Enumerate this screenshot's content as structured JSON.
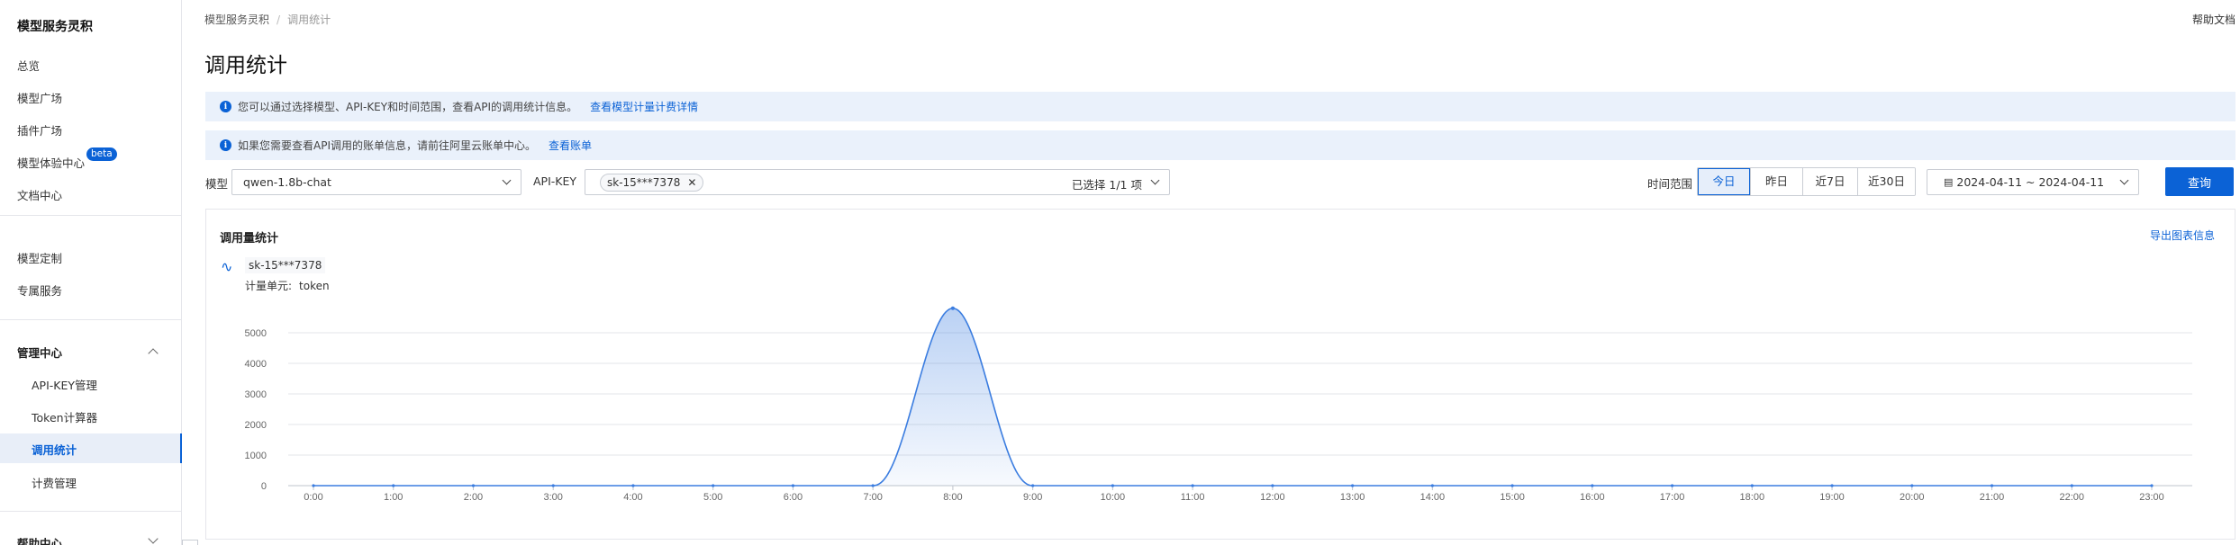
{
  "sidebar": {
    "brand": "模型服务灵积",
    "items": [
      {
        "label": "总览"
      },
      {
        "label": "模型广场"
      },
      {
        "label": "插件广场"
      },
      {
        "label": "模型体验中心",
        "badge": "beta"
      },
      {
        "label": "文档中心"
      }
    ],
    "items2": [
      {
        "label": "模型定制"
      },
      {
        "label": "专属服务"
      }
    ],
    "management": {
      "title": "管理中心",
      "items": [
        {
          "label": "API-KEY管理"
        },
        {
          "label": "Token计算器"
        },
        {
          "label": "调用统计",
          "active": true
        },
        {
          "label": "计费管理"
        }
      ]
    },
    "help": {
      "title": "帮助中心"
    }
  },
  "breadcrumb": {
    "root": "模型服务灵积",
    "separator": "/",
    "current": "调用统计"
  },
  "help_link": "帮助文档",
  "page_title": "调用统计",
  "notices": [
    {
      "text": "您可以通过选择模型、API-KEY和时间范围，查看API的调用统计信息。",
      "link": "查看模型计量计费详情"
    },
    {
      "text": "如果您需要查看API调用的账单信息，请前往阿里云账单中心。",
      "link": "查看账单"
    }
  ],
  "filters": {
    "model_label": "模型",
    "model_value": "qwen-1.8b-chat",
    "apikey_label": "API-KEY",
    "apikey_tag": "sk-15***7378",
    "apikey_selected": "已选择 1/1 项",
    "time_label": "时间范围",
    "ranges": [
      "今日",
      "昨日",
      "近7日",
      "近30日"
    ],
    "active_range": "今日",
    "date_range": "2024-04-11 ~ 2024-04-11",
    "query_label": "查询"
  },
  "panel": {
    "title": "调用量统计",
    "export": "导出图表信息",
    "legend": "sk-15***7378",
    "unit_label": "计量单元:",
    "unit_value": "token"
  },
  "colors": {
    "accent": "#0b62d6",
    "notice_bg": "#eaf1fb",
    "line": "#3b7de0"
  },
  "chart_data": {
    "type": "area",
    "x": [
      "0:00",
      "1:00",
      "2:00",
      "3:00",
      "4:00",
      "5:00",
      "6:00",
      "7:00",
      "8:00",
      "9:00",
      "10:00",
      "11:00",
      "12:00",
      "13:00",
      "14:00",
      "15:00",
      "16:00",
      "17:00",
      "18:00",
      "19:00",
      "20:00",
      "21:00",
      "22:00",
      "23:00"
    ],
    "series": [
      {
        "name": "sk-15***7378",
        "values": [
          0,
          0,
          0,
          0,
          0,
          0,
          0,
          0,
          5800,
          0,
          0,
          0,
          0,
          0,
          0,
          0,
          0,
          0,
          0,
          0,
          0,
          0,
          0,
          0
        ]
      }
    ],
    "yticks": [
      0,
      1000,
      2000,
      3000,
      4000,
      5000
    ],
    "ylim": [
      0,
      6000
    ],
    "grid": true
  }
}
